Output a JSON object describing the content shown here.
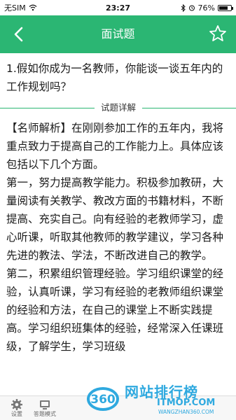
{
  "status_bar": {
    "carrier": "无SIM",
    "time": "23:27",
    "battery_percent": "76%",
    "battery_level": 0.76
  },
  "header": {
    "title": "面试题"
  },
  "question": {
    "text": "1.假如你成为一名教师，你能谈一谈五年内的工作规划吗？"
  },
  "divider": {
    "label": "试题详解"
  },
  "analysis": {
    "paragraphs": [
      "【名师解析】在刚刚参加工作的五年内，我将重点致力于提高自己的工作能力上。具体应该包括以下几个方面。",
      "第一，努力提高教学能力。积极参加教研，大量阅读有关教学、教改方面的书籍材料，不断提高、充实自己。向有经验的老教师学习，虚心听课，听取其他教师的教学建议，学习各种先进的教法、学法，不断改进自己的教学。",
      "第二，积累组织管理经验。学习组织课堂的经验，认真听课，学习有经验的老教师组织课堂的经验和方法，在自己的课堂上不断实践提高。学习组织班集体的经验，经常深入任课班级，了解学生，学习班级"
    ]
  },
  "bottom_bar": {
    "tabs": [
      {
        "label": "设置",
        "icon": "gear-icon"
      },
      {
        "label": "答题模式",
        "icon": "monitor-icon"
      }
    ]
  },
  "watermark": {
    "badge": "360",
    "text": "网站排行榜",
    "url": "ITMOP.COM",
    "sub": "WANGZHAN360.COM"
  },
  "colors": {
    "header": "#2bb673",
    "watermark": "#2fa9df"
  }
}
